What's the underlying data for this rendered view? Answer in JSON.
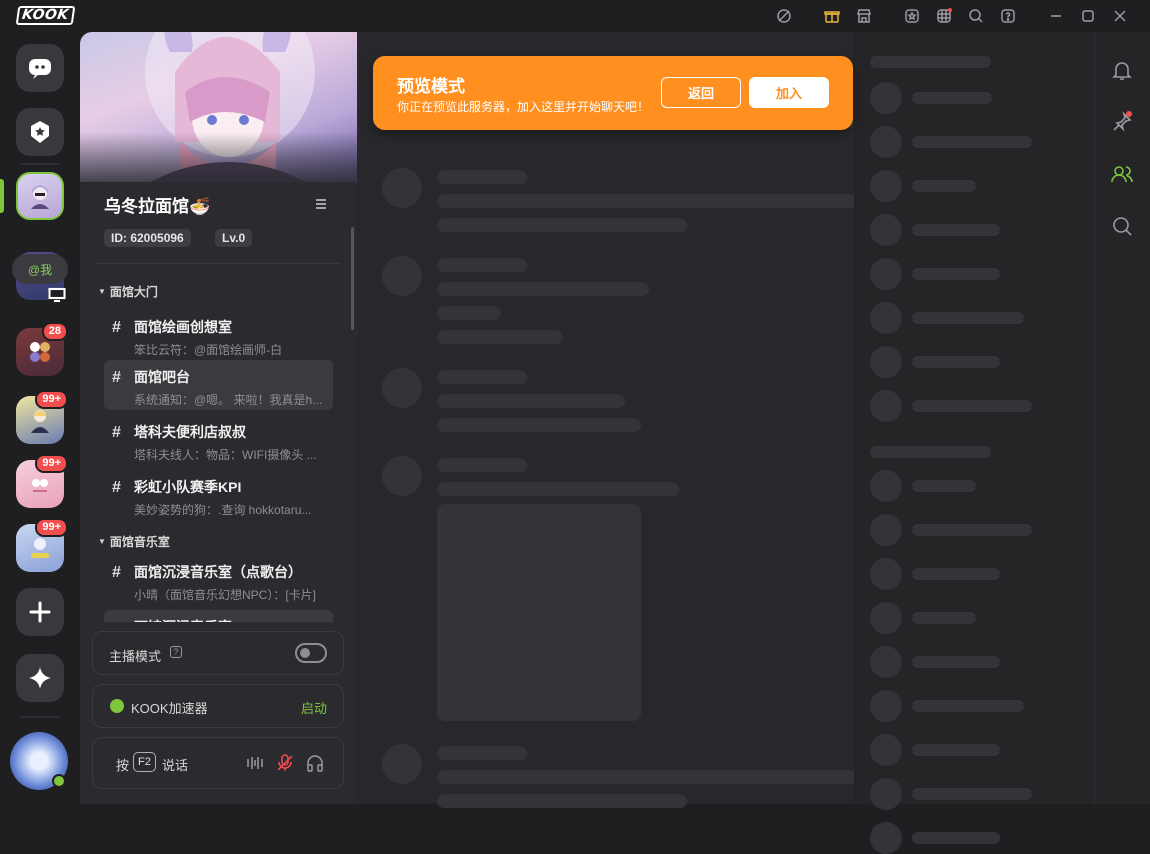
{
  "app": {
    "logo": "KOOK"
  },
  "titlebar": {
    "icons": [
      "nitro-icon",
      "gift-icon",
      "store-icon",
      "badge-icon",
      "grid-icon",
      "search-icon",
      "help-icon",
      "minimize-icon",
      "maximize-icon",
      "close-icon"
    ]
  },
  "guilds": {
    "at_me": "@我",
    "badges": [
      "28",
      "99+",
      "99+",
      "99+"
    ]
  },
  "server": {
    "name": "乌冬拉面馆🍜",
    "id_chip": "ID: 62005096",
    "level_chip": "Lv.0"
  },
  "categories": [
    {
      "name": "面馆大门"
    },
    {
      "name": "面馆音乐室"
    }
  ],
  "channels": [
    {
      "name": "面馆绘画创想室",
      "last": "笨比云符：@面馆绘画师-白"
    },
    {
      "name": "面馆吧台",
      "last": "系统通知：@嗯。 来啦！我真是h..."
    },
    {
      "name": "塔科夫便利店叔叔",
      "last": "塔科夫线人：物品：WIFI摄像头 ..."
    },
    {
      "name": "彩虹小队赛季KPI",
      "last": "美妙姿势的狗：.查询 hokkotaru..."
    },
    {
      "name": "面馆沉浸音乐室（点歌台）",
      "last": "小晴（面馆音乐幻想NPC）：[卡片]"
    },
    {
      "name": "面馆沉浸音乐室",
      "last": ""
    }
  ],
  "bottom": {
    "streamer_mode": "主播模式",
    "accelerator": "KOOK加速器",
    "accelerator_action": "启动",
    "ptt_prefix": "按",
    "ptt_key": "F2",
    "ptt_suffix": "说话"
  },
  "preview_banner": {
    "title": "预览模式",
    "description": "你正在预览此服务器，加入这里并开始聊天吧！",
    "back_label": "返回",
    "join_label": "加入"
  },
  "colors": {
    "accent_green": "#7ec63d",
    "preview_orange": "#ff8f1f",
    "badge_red": "#f24e4e"
  }
}
